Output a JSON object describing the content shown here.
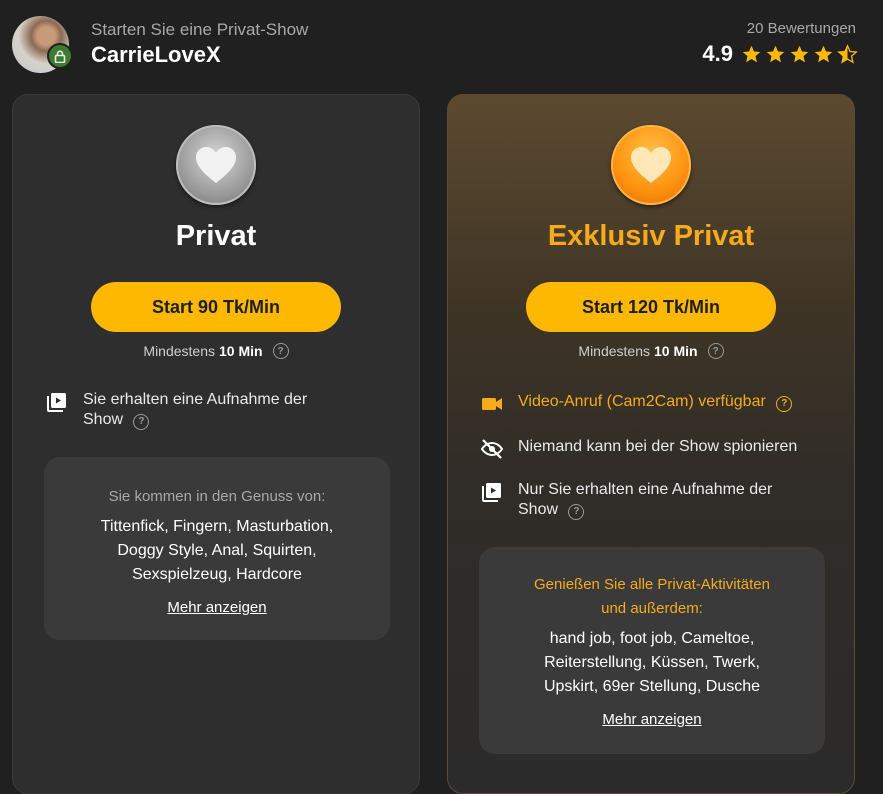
{
  "header": {
    "subtitle": "Starten Sie eine Privat-Show",
    "performer": "CarrieLoveX",
    "reviews": "20 Bewertungen",
    "rating": "4.9",
    "stars": 4.5
  },
  "private": {
    "title": "Privat",
    "button": "Start 90 Tk/Min",
    "minimum_prefix": "Mindestens",
    "minimum_value": "10 Min",
    "feature_recording_line1": "Sie erhalten eine Aufnahme der",
    "feature_recording_line2": "Show",
    "genres_head": "Sie kommen in den Genuss von:",
    "genres_line1": "Tittenfick, Fingern, Masturbation,",
    "genres_line2": "Doggy Style, Anal, Squirten,",
    "genres_line3": "Sexspielzeug, Hardcore",
    "more": "Mehr anzeigen"
  },
  "exclusive": {
    "title": "Exklusiv Privat",
    "button": "Start 120 Tk/Min",
    "minimum_prefix": "Mindestens",
    "minimum_value": "10 Min",
    "feature_cam2cam": "Video-Anruf (Cam2Cam) verfügbar",
    "feature_nospy": "Niemand kann bei der Show spionieren",
    "feature_recording_line1": "Nur Sie erhalten eine Aufnahme der",
    "feature_recording_line2": "Show",
    "genres_head_line1": "Genießen Sie alle Privat-Aktivitäten",
    "genres_head_line2": "und außerdem:",
    "genres_line1": "hand job, foot job, Cameltoe,",
    "genres_line2": "Reiterstellung, Küssen, Twerk,",
    "genres_line3": "Upskirt, 69er Stellung, Dusche",
    "more": "Mehr anzeigen"
  },
  "colors": {
    "accent": "#ffb800",
    "exclusive_title": "#f5ab1c",
    "background": "#202020"
  }
}
